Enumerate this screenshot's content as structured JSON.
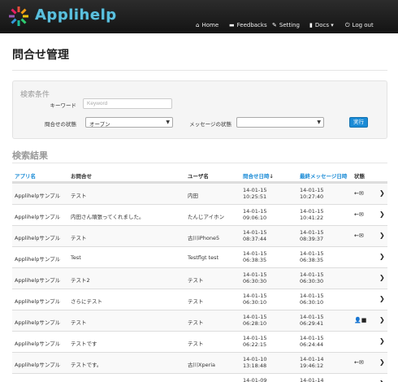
{
  "brand": "Applihelp",
  "nav": {
    "home": "Home",
    "feedbacks": "Feedbacks",
    "setting": "Setting",
    "docs": "Docs",
    "logout": "Log out"
  },
  "page_title": "問合せ管理",
  "search": {
    "title": "検索条件",
    "keyword_label": "キーワード",
    "keyword_placeholder": "Keyword",
    "status_label": "問合せの状態",
    "status_value": "オープン",
    "msg_status_label": "メッセージの状態",
    "msg_status_value": "",
    "submit": "実行"
  },
  "results": {
    "title": "検索結果",
    "headers": {
      "app": "アプリ名",
      "inquiry": "お問合せ",
      "user": "ユーザ名",
      "inquiry_date": "問合せ日時",
      "last_msg_date": "最終メッセージ日時",
      "status": "状態"
    },
    "rows": [
      {
        "app": "Applihelpサンプル",
        "inquiry": "テスト",
        "user": "内田",
        "d1": "14-01-15",
        "t1": "10:25:51",
        "d2": "14-01-15",
        "t2": "10:27:40",
        "status": "←✉"
      },
      {
        "app": "Applihelpサンプル",
        "inquiry": "内田さん頑張ってくれました。",
        "user": "たんじアイホン",
        "d1": "14-01-15",
        "t1": "09:06:10",
        "d2": "14-01-15",
        "t2": "10:41:22",
        "status": "←✉"
      },
      {
        "app": "Applihelpサンプル",
        "inquiry": "テスト",
        "user": "古川iPhone5",
        "d1": "14-01-15",
        "t1": "08:37:44",
        "d2": "14-01-15",
        "t2": "08:39:37",
        "status": "←✉"
      },
      {
        "app": "Applihelpサンプル",
        "inquiry": "Test",
        "user": "Testflgt test",
        "d1": "14-01-15",
        "t1": "06:38:35",
        "d2": "14-01-15",
        "t2": "06:38:35",
        "status": ""
      },
      {
        "app": "Applihelpサンプル",
        "inquiry": "テスト2",
        "user": "テスト",
        "d1": "14-01-15",
        "t1": "06:30:30",
        "d2": "14-01-15",
        "t2": "06:30:30",
        "status": ""
      },
      {
        "app": "Applihelpサンプル",
        "inquiry": "さらにテスト",
        "user": "テスト",
        "d1": "14-01-15",
        "t1": "06:30:10",
        "d2": "14-01-15",
        "t2": "06:30:10",
        "status": ""
      },
      {
        "app": "Applihelpサンプル",
        "inquiry": "テスト",
        "user": "テスト",
        "d1": "14-01-15",
        "t1": "06:28:10",
        "d2": "14-01-15",
        "t2": "06:29:41",
        "status": "👤■"
      },
      {
        "app": "Applihelpサンプル",
        "inquiry": "テストです",
        "user": "テスト",
        "d1": "14-01-15",
        "t1": "06:22:15",
        "d2": "14-01-15",
        "t2": "06:24:44",
        "status": ""
      },
      {
        "app": "Applihelpサンプル",
        "inquiry": "テストです。",
        "user": "古川Xperia",
        "d1": "14-01-10",
        "t1": "13:18:48",
        "d2": "14-01-14",
        "t2": "19:46:12",
        "status": "←✉"
      },
      {
        "app": "",
        "inquiry": "",
        "user": "",
        "d1": "14-01-09",
        "t1": "",
        "d2": "14-01-14",
        "t2": "",
        "status": ""
      }
    ]
  },
  "colors": {
    "navbar": "#1e1e1e",
    "brand": "#5bc0de",
    "link": "#1a8bd6",
    "button": "#1a8bd6"
  },
  "icons": {
    "home": "home-icon",
    "feedbacks": "comment-icon",
    "setting": "wrench-icon",
    "docs": "book-icon",
    "logout": "power-icon",
    "row_action": "chevron-right-icon"
  }
}
